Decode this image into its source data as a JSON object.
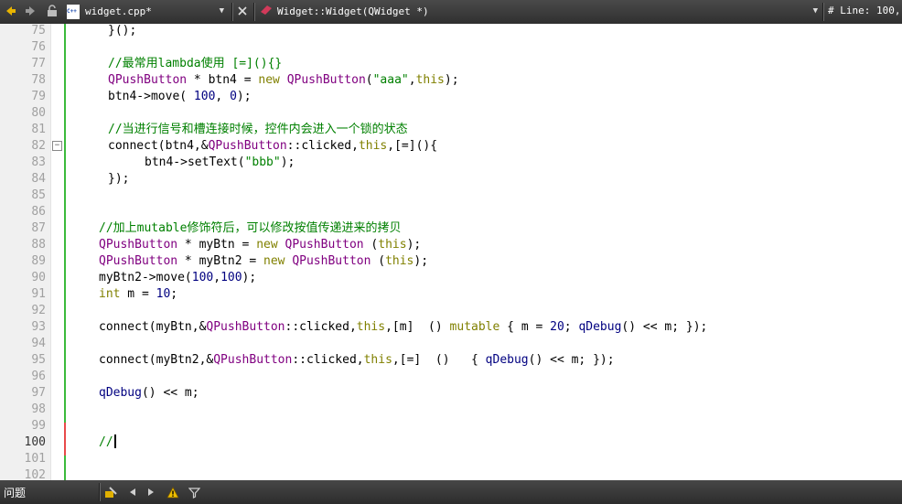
{
  "toolbar": {
    "file_name": "widget.cpp*",
    "file_badge": "C++",
    "function_name": "Widget::Widget(QWidget *)",
    "line_indicator": "#  Line: 100,"
  },
  "editor": {
    "lines": [
      {
        "n": "75",
        "indent": "i1",
        "segs": [
          {
            "t": "}();",
            "c": ""
          }
        ]
      },
      {
        "n": "76",
        "indent": "i1",
        "segs": []
      },
      {
        "n": "77",
        "indent": "i1",
        "segs": [
          {
            "t": "//最常用lambda使用 [=](){}",
            "c": "cm"
          }
        ]
      },
      {
        "n": "78",
        "indent": "i1",
        "segs": [
          {
            "t": "QPushButton",
            "c": "ty"
          },
          {
            "t": " * btn4 = ",
            "c": ""
          },
          {
            "t": "new",
            "c": "kw"
          },
          {
            "t": " ",
            "c": ""
          },
          {
            "t": "QPushButton",
            "c": "ty"
          },
          {
            "t": "(",
            "c": ""
          },
          {
            "t": "\"aaa\"",
            "c": "st"
          },
          {
            "t": ",",
            "c": ""
          },
          {
            "t": "this",
            "c": "kw"
          },
          {
            "t": ");",
            "c": ""
          }
        ]
      },
      {
        "n": "79",
        "indent": "i1",
        "segs": [
          {
            "t": "btn4->move( ",
            "c": ""
          },
          {
            "t": "100",
            "c": "nm"
          },
          {
            "t": ", ",
            "c": ""
          },
          {
            "t": "0",
            "c": "nm"
          },
          {
            "t": ");",
            "c": ""
          }
        ]
      },
      {
        "n": "80",
        "indent": "i1",
        "segs": []
      },
      {
        "n": "81",
        "indent": "i1",
        "segs": [
          {
            "t": "//当进行信号和槽连接时候，控件内会进入一个锁的状态",
            "c": "cm"
          }
        ]
      },
      {
        "n": "82",
        "indent": "i1",
        "fold": "−",
        "segs": [
          {
            "t": "connect(btn4,&",
            "c": ""
          },
          {
            "t": "QPushButton",
            "c": "ty"
          },
          {
            "t": "::clicked,",
            "c": ""
          },
          {
            "t": "this",
            "c": "kw"
          },
          {
            "t": ",[=](){",
            "c": ""
          }
        ]
      },
      {
        "n": "83",
        "indent": "i2",
        "segs": [
          {
            "t": "btn4->setText(",
            "c": ""
          },
          {
            "t": "\"bbb\"",
            "c": "st"
          },
          {
            "t": ");",
            "c": ""
          }
        ]
      },
      {
        "n": "84",
        "indent": "i1",
        "segs": [
          {
            "t": "});",
            "c": ""
          }
        ]
      },
      {
        "n": "85",
        "indent": "",
        "segs": []
      },
      {
        "n": "86",
        "indent": "",
        "segs": []
      },
      {
        "n": "87",
        "indent": "",
        "segs": [
          {
            "t": "//加上mutable修饰符后，可以修改按值传递进来的拷贝",
            "c": "cm"
          }
        ]
      },
      {
        "n": "88",
        "indent": "",
        "segs": [
          {
            "t": "QPushButton",
            "c": "ty"
          },
          {
            "t": " * myBtn = ",
            "c": ""
          },
          {
            "t": "new",
            "c": "kw"
          },
          {
            "t": " ",
            "c": ""
          },
          {
            "t": "QPushButton",
            "c": "ty"
          },
          {
            "t": " (",
            "c": ""
          },
          {
            "t": "this",
            "c": "kw"
          },
          {
            "t": ");",
            "c": ""
          }
        ]
      },
      {
        "n": "89",
        "indent": "",
        "segs": [
          {
            "t": "QPushButton",
            "c": "ty"
          },
          {
            "t": " * myBtn2 = ",
            "c": ""
          },
          {
            "t": "new",
            "c": "kw"
          },
          {
            "t": " ",
            "c": ""
          },
          {
            "t": "QPushButton",
            "c": "ty"
          },
          {
            "t": " (",
            "c": ""
          },
          {
            "t": "this",
            "c": "kw"
          },
          {
            "t": ");",
            "c": ""
          }
        ]
      },
      {
        "n": "90",
        "indent": "",
        "segs": [
          {
            "t": "myBtn2->move(",
            "c": ""
          },
          {
            "t": "100",
            "c": "nm"
          },
          {
            "t": ",",
            "c": ""
          },
          {
            "t": "100",
            "c": "nm"
          },
          {
            "t": ");",
            "c": ""
          }
        ]
      },
      {
        "n": "91",
        "indent": "",
        "segs": [
          {
            "t": "int",
            "c": "kw"
          },
          {
            "t": " m = ",
            "c": ""
          },
          {
            "t": "10",
            "c": "nm"
          },
          {
            "t": ";",
            "c": ""
          }
        ]
      },
      {
        "n": "92",
        "indent": "",
        "segs": []
      },
      {
        "n": "93",
        "indent": "",
        "segs": [
          {
            "t": "connect(myBtn,&",
            "c": ""
          },
          {
            "t": "QPushButton",
            "c": "ty"
          },
          {
            "t": "::clicked,",
            "c": ""
          },
          {
            "t": "this",
            "c": "kw"
          },
          {
            "t": ",[m]  () ",
            "c": ""
          },
          {
            "t": "mutable",
            "c": "kw"
          },
          {
            "t": " { m = ",
            "c": ""
          },
          {
            "t": "20",
            "c": "nm"
          },
          {
            "t": "; ",
            "c": ""
          },
          {
            "t": "qDebug",
            "c": "nm"
          },
          {
            "t": "() << m; });",
            "c": ""
          }
        ]
      },
      {
        "n": "94",
        "indent": "",
        "segs": []
      },
      {
        "n": "95",
        "indent": "",
        "segs": [
          {
            "t": "connect(myBtn2,&",
            "c": ""
          },
          {
            "t": "QPushButton",
            "c": "ty"
          },
          {
            "t": "::clicked,",
            "c": ""
          },
          {
            "t": "this",
            "c": "kw"
          },
          {
            "t": ",[=]  ()   { ",
            "c": ""
          },
          {
            "t": "qDebug",
            "c": "nm"
          },
          {
            "t": "() << m; });",
            "c": ""
          }
        ]
      },
      {
        "n": "96",
        "indent": "",
        "segs": []
      },
      {
        "n": "97",
        "indent": "",
        "segs": [
          {
            "t": "qDebug",
            "c": "nm"
          },
          {
            "t": "() << m;",
            "c": ""
          }
        ]
      },
      {
        "n": "98",
        "indent": "",
        "segs": []
      },
      {
        "n": "99",
        "indent": "",
        "segs": []
      },
      {
        "n": "100",
        "indent": "",
        "current": true,
        "caret": true,
        "segs": [
          {
            "t": "//",
            "c": "cm"
          }
        ]
      },
      {
        "n": "101",
        "indent": "",
        "segs": []
      },
      {
        "n": "102",
        "indent": "",
        "segs": []
      }
    ]
  },
  "bottombar": {
    "label": "问题"
  },
  "colors": {
    "comment": "#008000",
    "type": "#800080",
    "keyword": "#808000",
    "string": "#008000",
    "number": "#000080",
    "change_bar": "#3cba3c",
    "bar_bg": "#3a3a3a"
  }
}
